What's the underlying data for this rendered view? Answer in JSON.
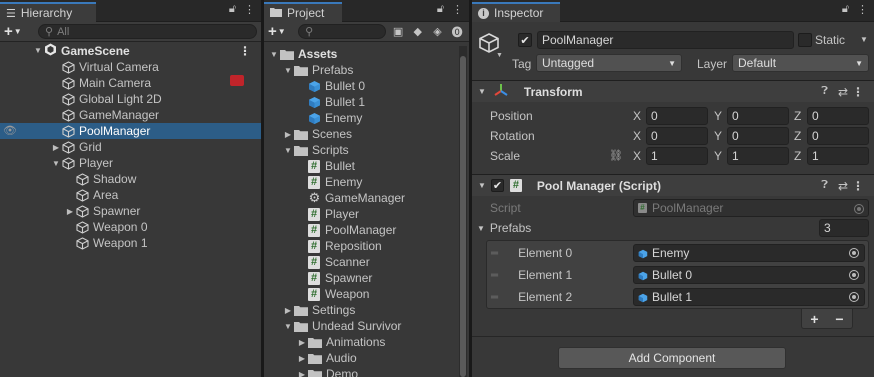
{
  "hierarchy": {
    "tab_label": "Hierarchy",
    "search_placeholder": "All",
    "scene": "GameScene",
    "items": [
      {
        "label": "Virtual Camera",
        "indent": 1,
        "arrow": ""
      },
      {
        "label": "Main Camera",
        "indent": 1,
        "arrow": ""
      },
      {
        "label": "Global Light 2D",
        "indent": 1,
        "arrow": ""
      },
      {
        "label": "GameManager",
        "indent": 1,
        "arrow": ""
      },
      {
        "label": "PoolManager",
        "indent": 1,
        "arrow": "",
        "selected": true
      },
      {
        "label": "Grid",
        "indent": 1,
        "arrow": "▶"
      },
      {
        "label": "Player",
        "indent": 1,
        "arrow": "▼"
      },
      {
        "label": "Shadow",
        "indent": 2,
        "arrow": ""
      },
      {
        "label": "Area",
        "indent": 2,
        "arrow": ""
      },
      {
        "label": "Spawner",
        "indent": 2,
        "arrow": "▶"
      },
      {
        "label": "Weapon 0",
        "indent": 2,
        "arrow": ""
      },
      {
        "label": "Weapon 1",
        "indent": 2,
        "arrow": ""
      }
    ]
  },
  "project": {
    "tab_label": "Project",
    "items": [
      {
        "label": "Assets",
        "indent": 0,
        "arrow": "▼",
        "icon": "folder",
        "bold": true
      },
      {
        "label": "Prefabs",
        "indent": 1,
        "arrow": "▼",
        "icon": "folder"
      },
      {
        "label": "Bullet 0",
        "indent": 2,
        "arrow": "",
        "icon": "prefab"
      },
      {
        "label": "Bullet 1",
        "indent": 2,
        "arrow": "",
        "icon": "prefab"
      },
      {
        "label": "Enemy",
        "indent": 2,
        "arrow": "",
        "icon": "prefab"
      },
      {
        "label": "Scenes",
        "indent": 1,
        "arrow": "▶",
        "icon": "folder"
      },
      {
        "label": "Scripts",
        "indent": 1,
        "arrow": "▼",
        "icon": "folder"
      },
      {
        "label": "Bullet",
        "indent": 2,
        "arrow": "",
        "icon": "script"
      },
      {
        "label": "Enemy",
        "indent": 2,
        "arrow": "",
        "icon": "script"
      },
      {
        "label": "GameManager",
        "indent": 2,
        "arrow": "",
        "icon": "gear"
      },
      {
        "label": "Player",
        "indent": 2,
        "arrow": "",
        "icon": "script"
      },
      {
        "label": "PoolManager",
        "indent": 2,
        "arrow": "",
        "icon": "script"
      },
      {
        "label": "Reposition",
        "indent": 2,
        "arrow": "",
        "icon": "script"
      },
      {
        "label": "Scanner",
        "indent": 2,
        "arrow": "",
        "icon": "script"
      },
      {
        "label": "Spawner",
        "indent": 2,
        "arrow": "",
        "icon": "script"
      },
      {
        "label": "Weapon",
        "indent": 2,
        "arrow": "",
        "icon": "script"
      },
      {
        "label": "Settings",
        "indent": 1,
        "arrow": "▶",
        "icon": "folder"
      },
      {
        "label": "Undead Survivor",
        "indent": 1,
        "arrow": "▼",
        "icon": "folder"
      },
      {
        "label": "Animations",
        "indent": 2,
        "arrow": "▶",
        "icon": "folder"
      },
      {
        "label": "Audio",
        "indent": 2,
        "arrow": "▶",
        "icon": "folder"
      },
      {
        "label": "Demo",
        "indent": 2,
        "arrow": "▶",
        "icon": "folder"
      }
    ]
  },
  "inspector": {
    "tab_label": "Inspector",
    "object_name": "PoolManager",
    "static_label": "Static",
    "tag_label": "Tag",
    "tag_value": "Untagged",
    "layer_label": "Layer",
    "layer_value": "Default",
    "transform": {
      "title": "Transform",
      "position_label": "Position",
      "rotation_label": "Rotation",
      "scale_label": "Scale",
      "axis_x": "X",
      "axis_y": "Y",
      "axis_z": "Z",
      "position": [
        "0",
        "0",
        "0"
      ],
      "rotation": [
        "0",
        "0",
        "0"
      ],
      "scale": [
        "1",
        "1",
        "1"
      ]
    },
    "pool_manager": {
      "title": "Pool Manager (Script)",
      "script_label": "Script",
      "script_value": "PoolManager",
      "prefabs_label": "Prefabs",
      "prefabs_count": "3",
      "elements": [
        {
          "label": "Element 0",
          "value": "Enemy"
        },
        {
          "label": "Element 1",
          "value": "Bullet 0"
        },
        {
          "label": "Element 2",
          "value": "Bullet 1"
        }
      ],
      "plus": "+",
      "minus": "−"
    },
    "add_component": "Add Component"
  },
  "colors": {
    "accent": "#3a79bb",
    "selection": "#2c5d87",
    "panel": "#383838"
  }
}
